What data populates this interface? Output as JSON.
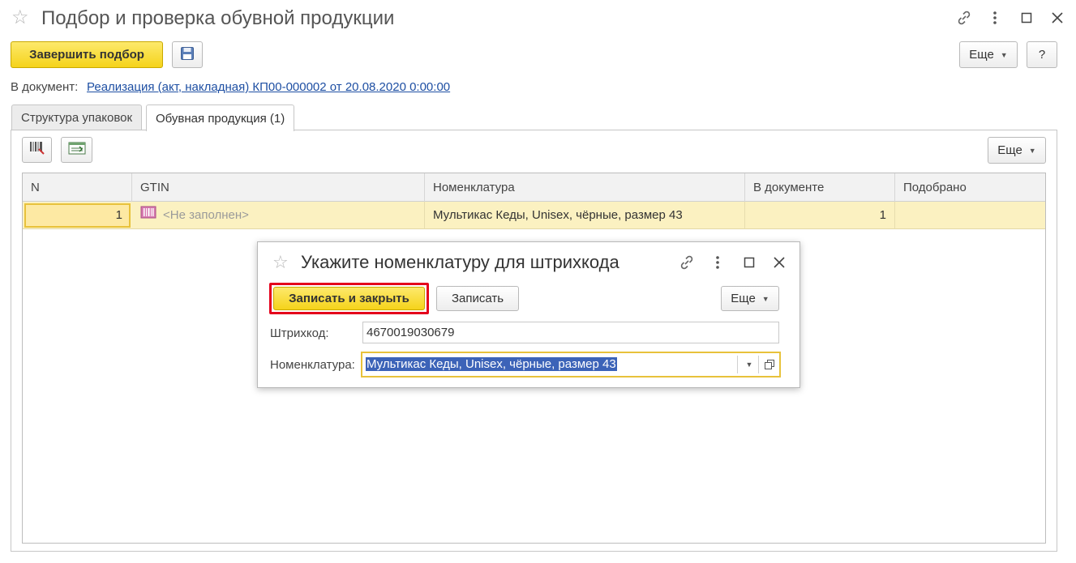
{
  "window": {
    "title": "Подбор и проверка обувной продукции",
    "star_icon": "star-icon",
    "link_icon": "link-icon",
    "menu_icon": "kebab-menu-icon",
    "maximize_icon": "maximize-icon",
    "close_icon": "close-icon"
  },
  "toolbar": {
    "finish_label": "Завершить подбор",
    "save_icon": "floppy-disk-icon",
    "more_label": "Еще",
    "help_label": "?"
  },
  "document": {
    "label": "В документ:",
    "link": "Реализация (акт, накладная) КП00-000002 от 20.08.2020 0:00:00"
  },
  "tabs": [
    {
      "label": "Структура упаковок",
      "active": false
    },
    {
      "label": "Обувная продукция (1)",
      "active": true
    }
  ],
  "panel_toolbar": {
    "barcode_icon": "barcode-scan-icon",
    "list_icon": "load-list-icon",
    "more_label": "Еще"
  },
  "table": {
    "columns": [
      "N",
      "GTIN",
      "Номенклатура",
      "В документе",
      "Подобрано"
    ],
    "rows": [
      {
        "n": "1",
        "gtin": "<Не заполнен>",
        "nomenclature": "Мультикас Кеды, Unisex, чёрные, размер 43",
        "in_document": "1",
        "picked": ""
      }
    ]
  },
  "modal": {
    "title": "Укажите номенклатуру для штрихкода",
    "save_close_label": "Записать и закрыть",
    "save_label": "Записать",
    "more_label": "Еще",
    "barcode_label": "Штрихкод:",
    "barcode_value": "4670019030679",
    "nomenclature_label": "Номенклатура:",
    "nomenclature_value": "Мультикас Кеды, Unisex, чёрные, размер 43"
  },
  "colors": {
    "accent_yellow": "#f5d31a",
    "highlight_red": "#e4001b",
    "link_blue": "#1e4fa3",
    "selection_blue": "#3c63b8",
    "row_highlight": "#fbf1c1"
  }
}
